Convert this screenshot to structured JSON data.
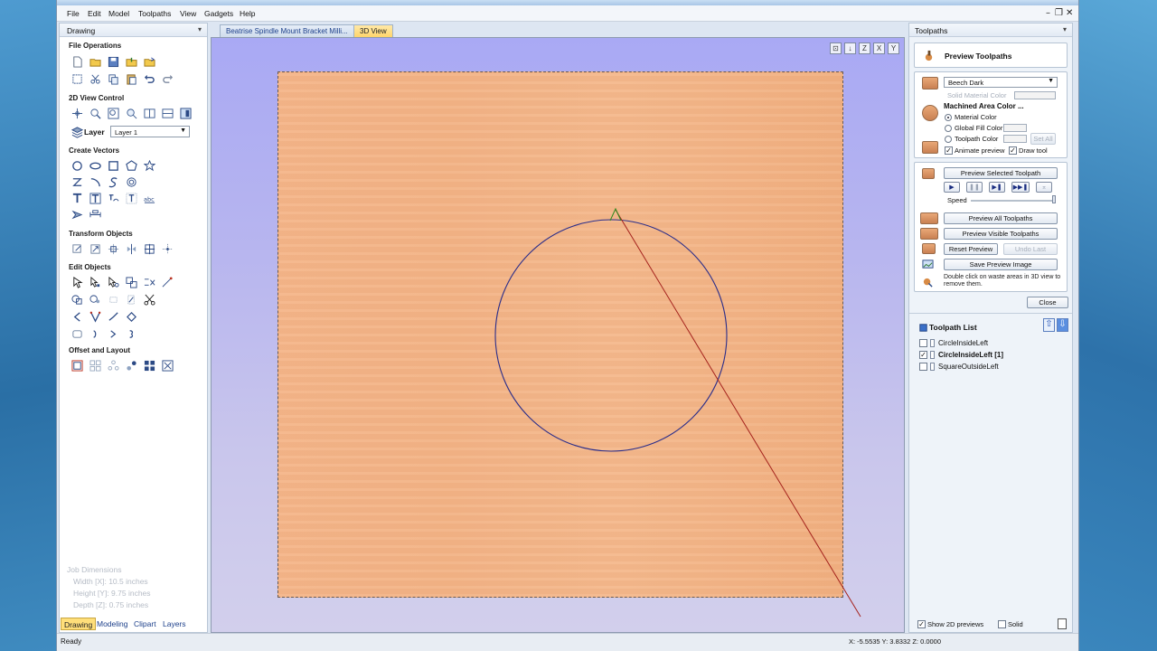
{
  "menu": {
    "items": [
      "File",
      "Edit",
      "Model",
      "Toolpaths",
      "View",
      "Gadgets",
      "Help"
    ]
  },
  "window_controls": [
    "–",
    "❐",
    "✕"
  ],
  "left_panel": {
    "header": "Drawing",
    "pin": "▾",
    "sections": {
      "file_ops": "File Operations",
      "view_control": "2D View Control",
      "create_vectors": "Create Vectors",
      "transform": "Transform Objects",
      "edit_objects": "Edit Objects",
      "offset_layout": "Offset and Layout"
    },
    "layer_label": "Layer",
    "layer_value": "Layer 1",
    "job_dimensions": {
      "title": "Job Dimensions",
      "width": "Width  [X]: 10.5 inches",
      "height": "Height [Y]: 9.75 inches",
      "depth": "Depth  [Z]: 0.75 inches"
    },
    "bottom_tabs": [
      "Drawing",
      "Modeling",
      "Clipart",
      "Layers"
    ]
  },
  "doc_tabs": [
    "Beatrise Spindle Mount Bracket Milli...",
    "3D View"
  ],
  "view_icons": [
    "⊡",
    "↓",
    "Z",
    "X",
    "Y"
  ],
  "right_panel": {
    "header": "Toolpaths",
    "pin": "▾",
    "preview_title": "Preview Toolpaths",
    "material": "Beech Dark",
    "solid_material_color": "Solid Material Color",
    "machined_area_color": "Machined Area Color ...",
    "opt_material": "Material Color",
    "opt_global": "Global Fill Color",
    "opt_toolpath": "Toolpath Color",
    "set_all": "Set All",
    "animate_preview": "Animate preview",
    "draw_tool": "Draw tool",
    "preview_selected": "Preview Selected Toolpath",
    "speed": "Speed",
    "preview_all": "Preview All Toolpaths",
    "preview_visible": "Preview Visible Toolpaths",
    "reset_preview": "Reset Preview",
    "undo_last": "Undo Last",
    "save_preview": "Save Preview Image",
    "hint": "Double click on waste areas in 3D view to remove them.",
    "close": "Close",
    "toolpath_list_title": "Toolpath List",
    "toolpaths": [
      {
        "name": "CircleInsideLeft",
        "checked": false,
        "bold": false
      },
      {
        "name": "CircleInsideLeft [1]",
        "checked": true,
        "bold": true
      },
      {
        "name": "SquareOutsideLeft",
        "checked": false,
        "bold": false
      }
    ],
    "show_2d_previews": "Show 2D previews",
    "solid": "Solid",
    "play_controls": [
      "▶",
      "❚❚",
      "▶❚",
      "▶▶❚",
      "⌅"
    ]
  },
  "status": {
    "ready": "Ready",
    "coords": "X: -5.5535  Y: 3.8332  Z: 0.0000"
  },
  "colors": {
    "toolpath_circle": "#2a2d8a",
    "tool_line": "#a4221c",
    "tool_tip": "#2f8a1e",
    "active_tab": "#ffd56b"
  }
}
